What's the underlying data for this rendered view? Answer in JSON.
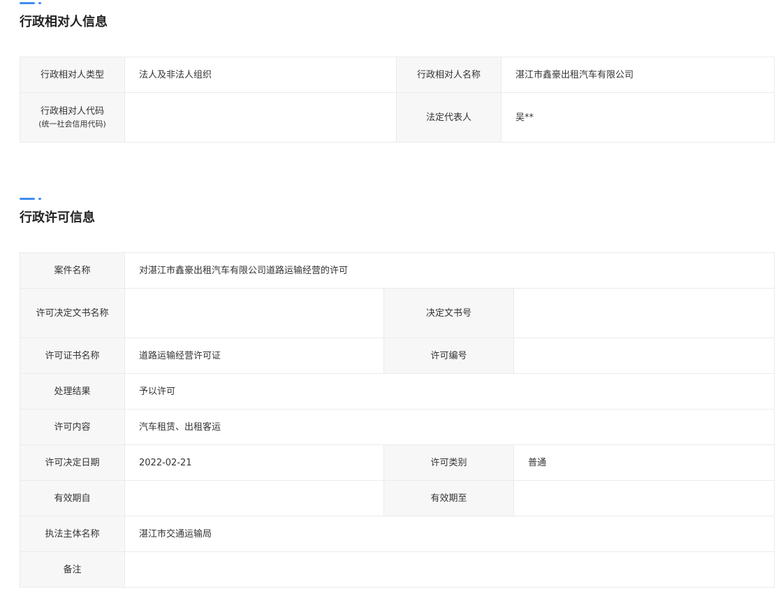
{
  "subject_section": {
    "title": "行政相对人信息",
    "type_label": "行政相对人类型",
    "type_value": "法人及非法人组织",
    "name_label": "行政相对人名称",
    "name_value": "湛江市鑫豪出租汽车有限公司",
    "code_label": "行政相对人代码",
    "code_sublabel": "(统一社会信用代码)",
    "code_value": "",
    "rep_label": "法定代表人",
    "rep_value": "吴**"
  },
  "license_section": {
    "title": "行政许可信息",
    "case_name_label": "案件名称",
    "case_name_value": "对湛江市鑫豪出租汽车有限公司道路运输经营的许可",
    "doc_name_label": "许可决定文书名称",
    "doc_name_value": "",
    "doc_no_label": "决定文书号",
    "doc_no_value": "",
    "cert_name_label": "许可证书名称",
    "cert_name_value": "道路运输经营许可证",
    "license_no_label": "许可编号",
    "license_no_value": "",
    "result_label": "处理结果",
    "result_value": "予以许可",
    "content_label": "许可内容",
    "content_value": "汽车租赁、出租客运",
    "date_label": "许可决定日期",
    "date_value": "2022-02-21",
    "category_label": "许可类别",
    "category_value": "普通",
    "valid_from_label": "有效期自",
    "valid_from_value": "",
    "valid_to_label": "有效期至",
    "valid_to_value": "",
    "authority_label": "执法主体名称",
    "authority_value": "湛江市交通运输局",
    "remark_label": "备注",
    "remark_value": ""
  }
}
